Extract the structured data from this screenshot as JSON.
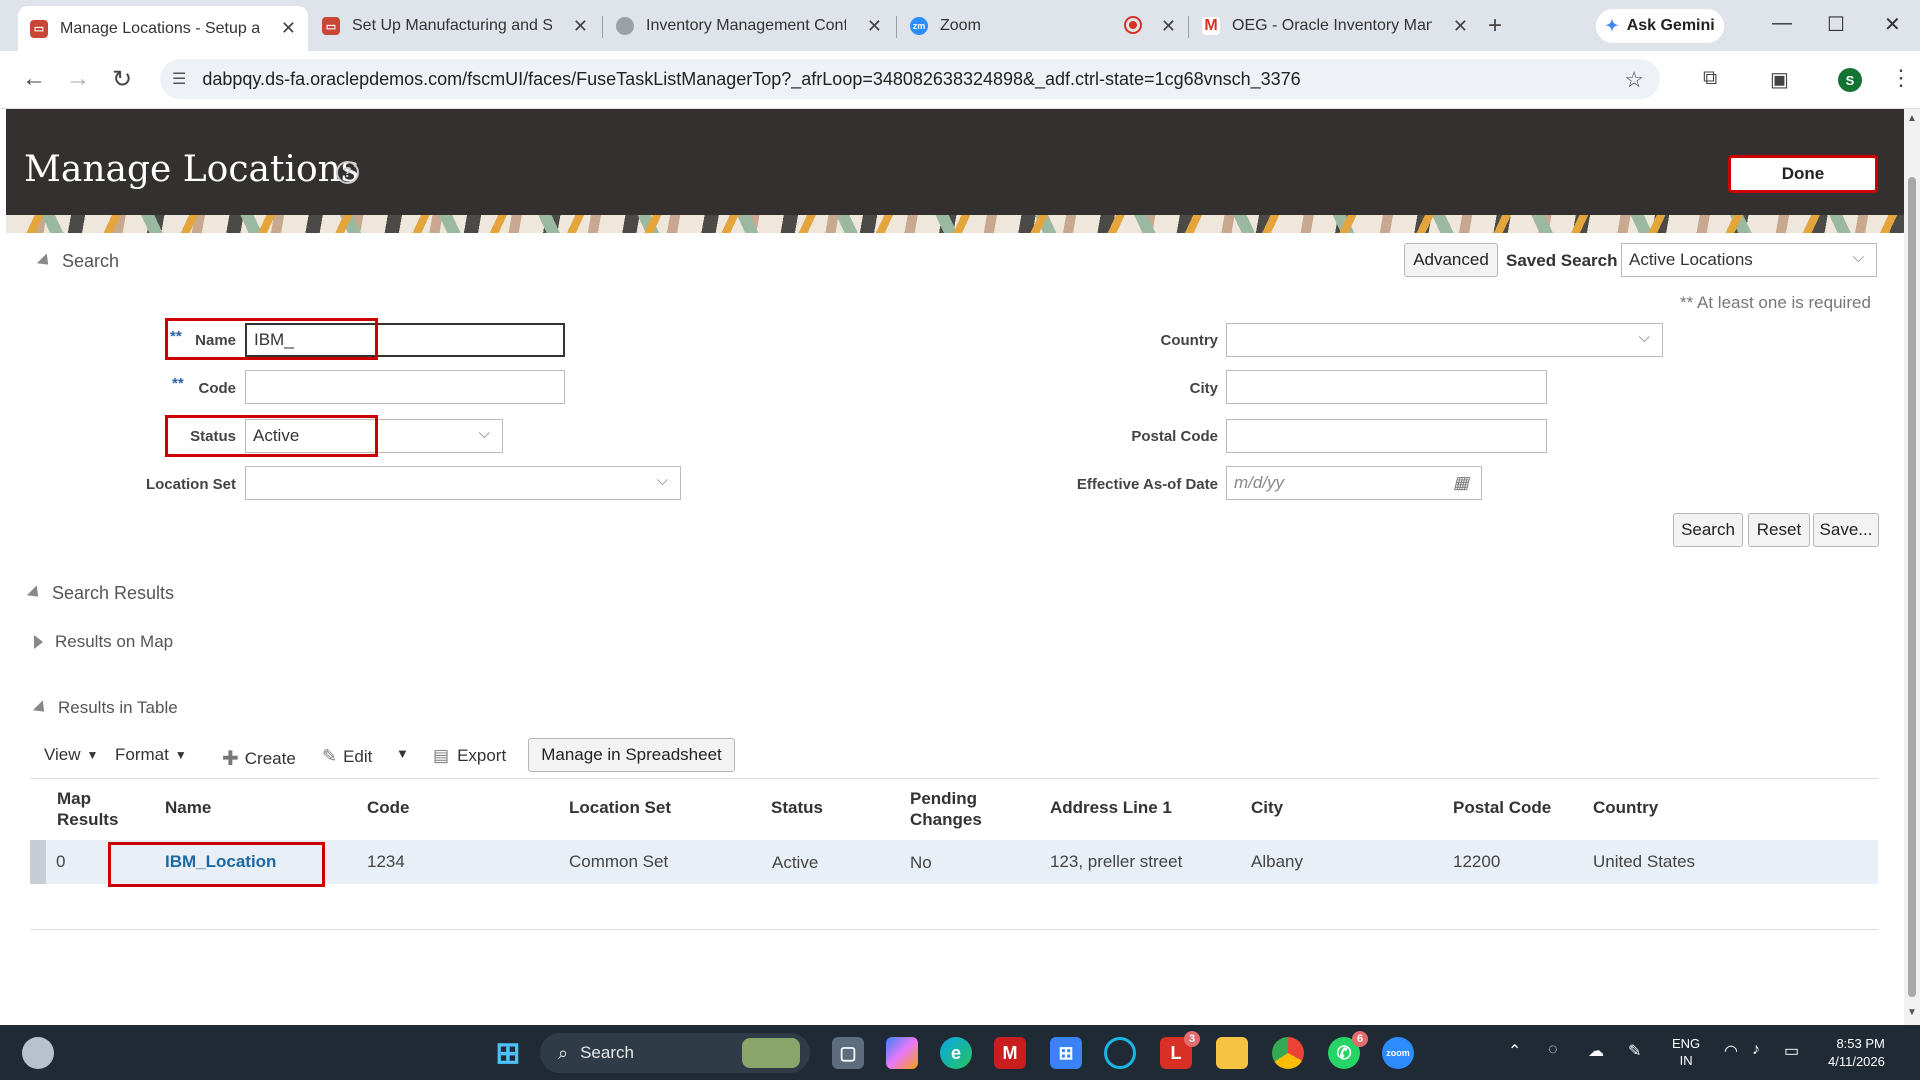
{
  "browser": {
    "tabs": [
      {
        "title": "Manage Locations - Setup and",
        "icon": "oracle-icon"
      },
      {
        "title": "Set Up Manufacturing and Sup",
        "icon": "oracle-icon"
      },
      {
        "title": "Inventory Management Config",
        "icon": "globe-icon"
      },
      {
        "title": "Zoom",
        "icon": "zoom-icon"
      },
      {
        "title": "OEG - Oracle Inventory Manag",
        "icon": "gmail-icon"
      }
    ],
    "gemini_label": "Ask Gemini",
    "url": "dabpqy.ds-fa.oraclepdemos.com/fscmUI/faces/FuseTaskListManagerTop?_afrLoop=348082638324898&_adf.ctrl-state=1cg68vnsch_3376",
    "profile_initial": "S"
  },
  "header": {
    "title": "Manage Locations",
    "done_label": "Done"
  },
  "search": {
    "section_label": "Search",
    "advanced_label": "Advanced",
    "saved_search_label": "Saved Search",
    "saved_search_value": "Active Locations",
    "required_hint": "** At least one is required",
    "required_marker": "**",
    "fields": {
      "name_label": "Name",
      "name_value": "IBM_",
      "code_label": "Code",
      "code_value": "",
      "status_label": "Status",
      "status_value": "Active",
      "location_set_label": "Location Set",
      "location_set_value": "",
      "country_label": "Country",
      "country_value": "",
      "city_label": "City",
      "city_value": "",
      "postal_code_label": "Postal Code",
      "postal_code_value": "",
      "effective_date_label": "Effective As-of Date",
      "effective_date_placeholder": "m/d/yy"
    },
    "buttons": {
      "search": "Search",
      "reset": "Reset",
      "save": "Save..."
    }
  },
  "results": {
    "section_label": "Search Results",
    "map_label": "Results on Map",
    "table_label": "Results in Table",
    "toolbar": {
      "view": "View",
      "format": "Format",
      "create": "Create",
      "edit": "Edit",
      "export": "Export",
      "manage_spreadsheet": "Manage in Spreadsheet"
    },
    "columns": {
      "map_results_1": "Map",
      "map_results_2": "Results",
      "name": "Name",
      "code": "Code",
      "location_set": "Location Set",
      "status": "Status",
      "pending_1": "Pending",
      "pending_2": "Changes",
      "address": "Address Line 1",
      "city": "City",
      "postal_code": "Postal Code",
      "country": "Country"
    },
    "row": {
      "map_results": "0",
      "name": "IBM_Location",
      "code": "1234",
      "location_set": "Common Set",
      "status": "Active",
      "pending_changes": "No",
      "address": "123, preller street",
      "city": "Albany",
      "postal_code": "12200",
      "country": "United States"
    }
  },
  "taskbar": {
    "search_label": "Search",
    "badges": {
      "l_app": "3",
      "whatsapp": "6"
    },
    "lang_1": "ENG",
    "lang_2": "IN",
    "time": "8:53 PM",
    "date": "4/11/2026"
  },
  "colors": {
    "annotation": "#cc0000",
    "header_bg": "#33302f",
    "link": "#1c6aa3"
  }
}
